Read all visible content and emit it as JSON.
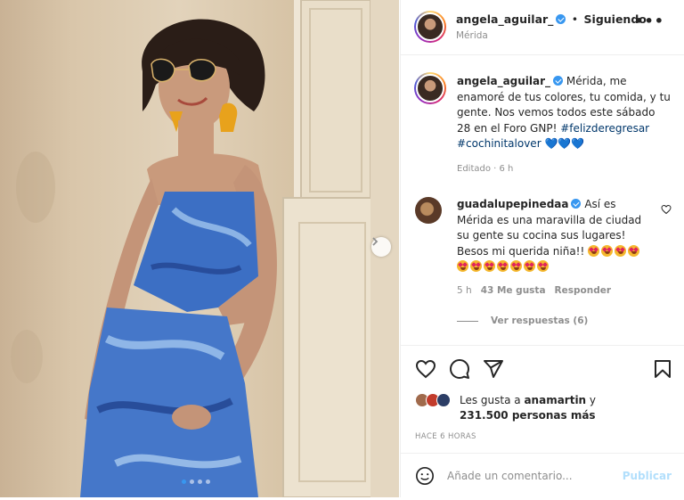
{
  "post": {
    "username": "angela_aguilar_",
    "follow_separator": "•",
    "follow_label": "Siguiendo",
    "location": "Mérida",
    "more_label": "•••"
  },
  "caption": {
    "username": "angela_aguilar_",
    "text": "Mérida, me enamoré de tus colores, tu comida, y tu gente. Nos vemos todos este sábado 28 en el Foro GNP!",
    "hashtag1": "#felizderegresar",
    "hashtag2": "#cochinitalover",
    "hearts": "💙💙💙",
    "meta": "Editado · 6 h"
  },
  "comment": {
    "username": "guadalupepinedaa",
    "text": "Así es Mérida es una maravilla de ciudad su gente su cocina sus lugares! Besos mi querida niña!!",
    "emoji_count": 11,
    "time": "5 h",
    "likes": "43 Me gusta",
    "reply": "Responder",
    "view_replies": "Ver respuestas (6)"
  },
  "likes": {
    "prefix": "Les gusta a ",
    "user": "anamartin",
    "connector": " y",
    "count": "231.500 personas más"
  },
  "time_ago": "HACE 6 HORAS",
  "add_comment": {
    "placeholder": "Añade un comentario...",
    "publish": "Publicar"
  },
  "carousel": {
    "slides": 4,
    "active": 0
  },
  "colors": {
    "link": "#00376b",
    "accent": "#3897f0",
    "muted": "#8e8e8e",
    "publish_disabled": "#b2dffc"
  }
}
